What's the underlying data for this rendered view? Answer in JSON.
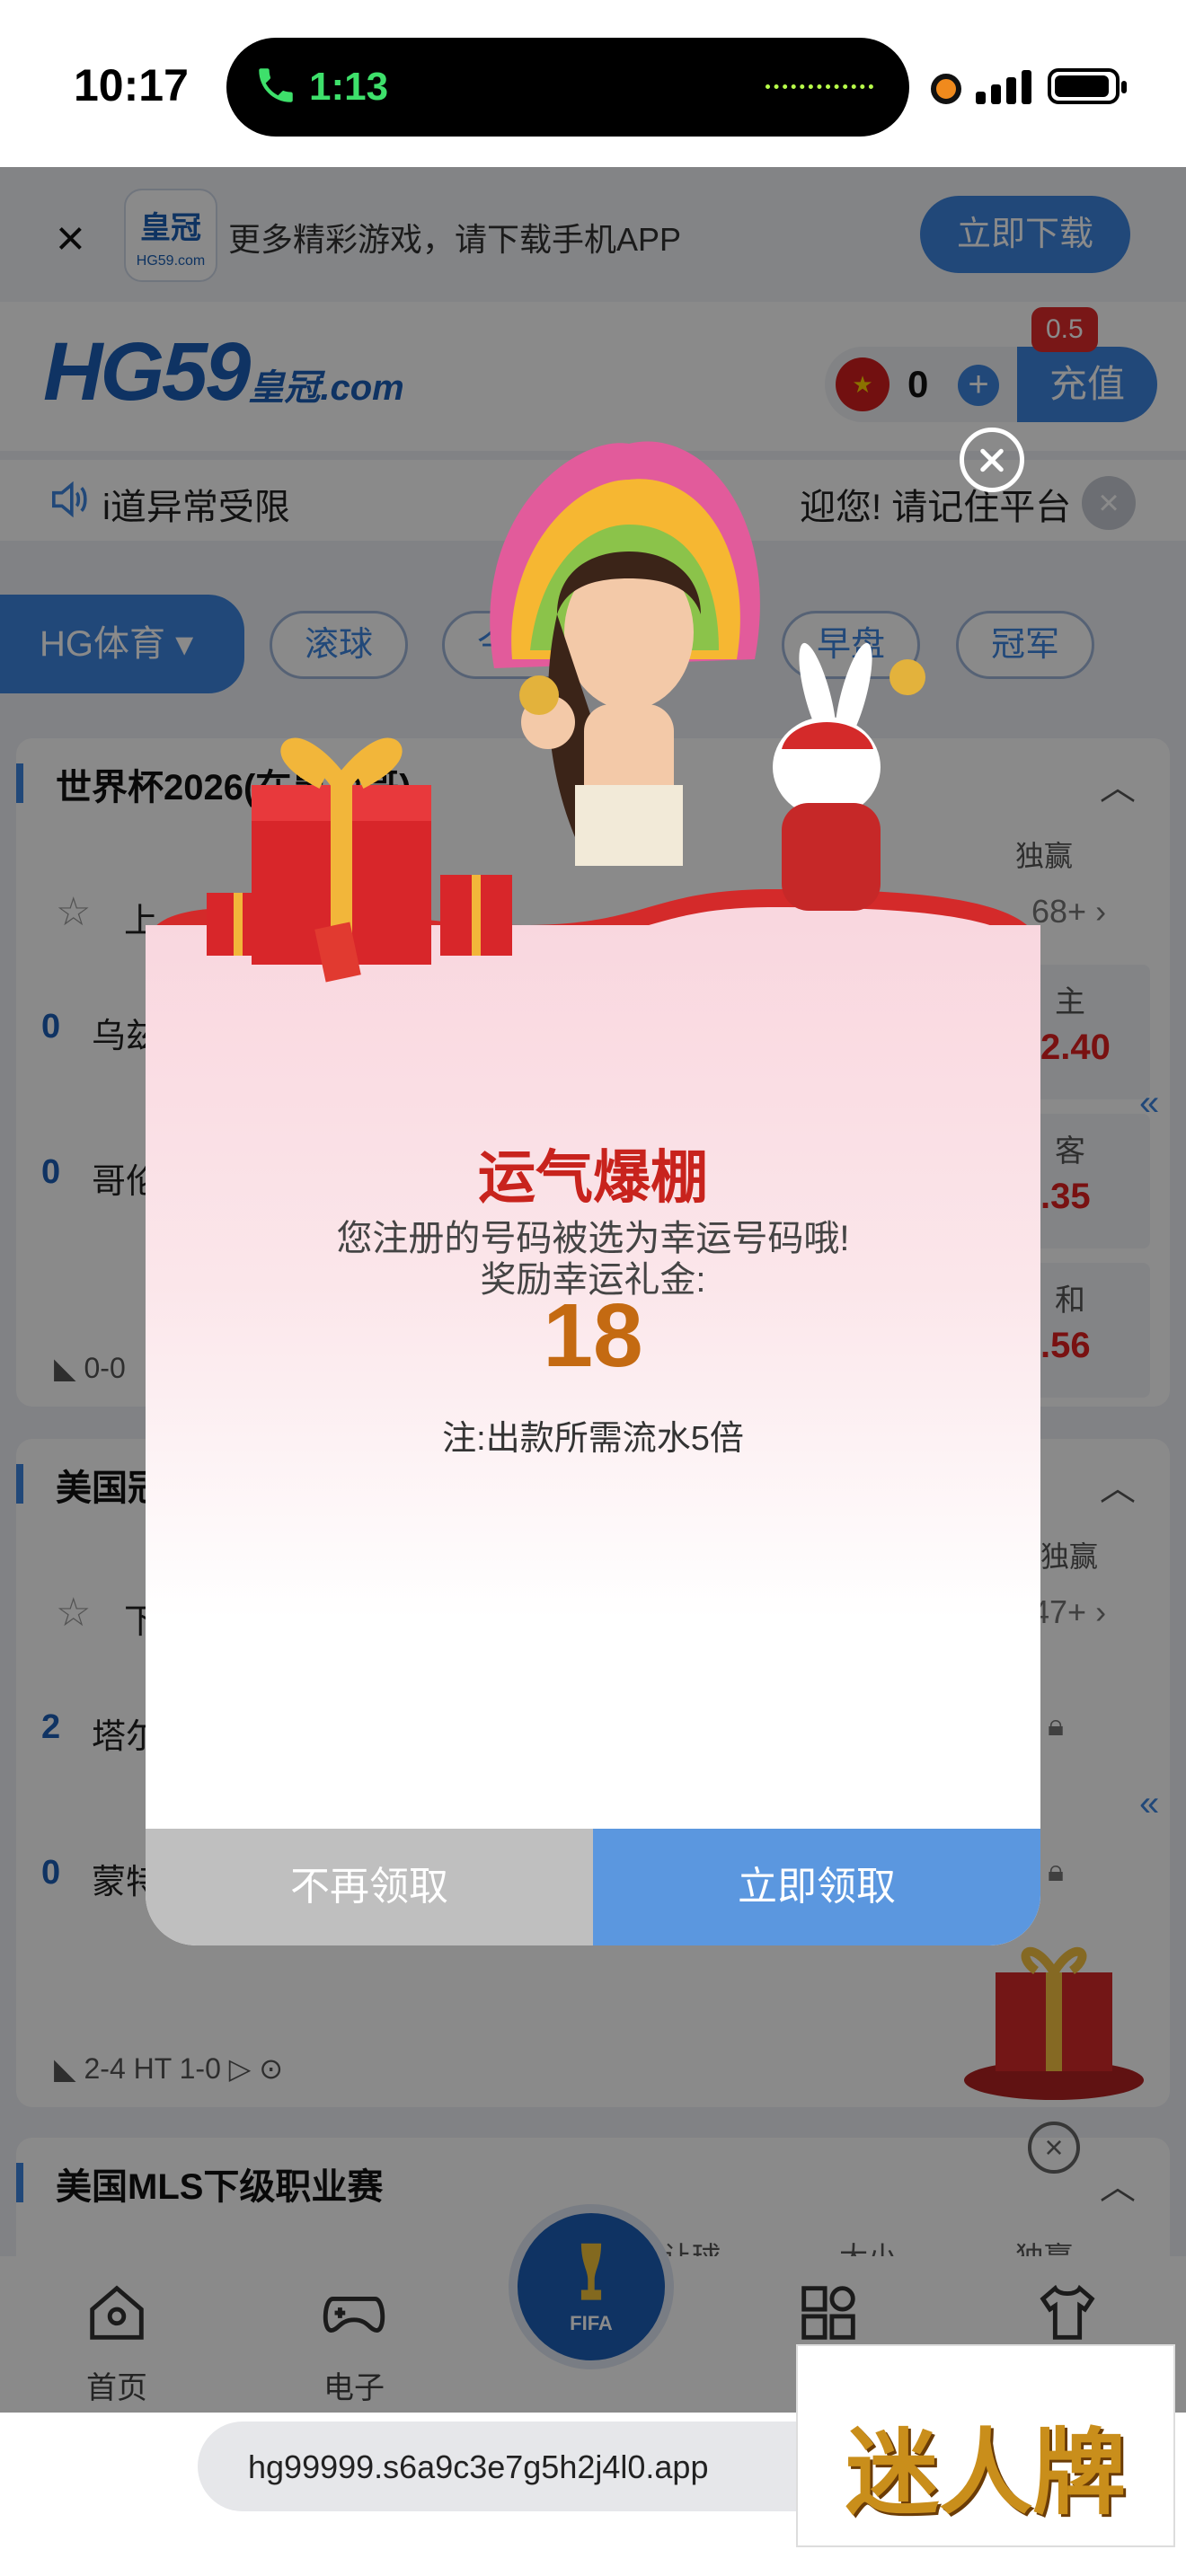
{
  "status_bar": {
    "time": "10:17",
    "call_time": "1:13"
  },
  "download_banner": {
    "logo_cn": "皇冠",
    "logo_domain": "HG59.com",
    "text": "更多精彩游戏，请下载手机APP",
    "button": "立即下载"
  },
  "header": {
    "brand": "HG59",
    "brand_cn": "皇冠",
    "brand_suffix": ".com",
    "balance": "0",
    "recharge": "充值",
    "bonus_badge": "0.5"
  },
  "marquee": {
    "left_text": "i道异常受限",
    "right_text": "迎您! 请记住平台"
  },
  "filters": {
    "main": "HG体育",
    "chips": [
      "滚球",
      "今日",
      "早盘",
      "冠军"
    ]
  },
  "matches": [
    {
      "league": "世界杯2026(在墨西哥)",
      "columns": [
        "独赢"
      ],
      "row_prefix": "上",
      "more": "68+",
      "teams": [
        {
          "score": "0",
          "name": "乌兹"
        },
        {
          "score": "0",
          "name": "哥伦"
        }
      ],
      "odds": [
        {
          "label": "主",
          "value": "2.40"
        },
        {
          "label": "客",
          "value": ".35"
        },
        {
          "label": "和",
          "value": ".56"
        }
      ],
      "live": "0-0"
    },
    {
      "league": "美国冠",
      "columns": [
        "独赢"
      ],
      "row_prefix": "下",
      "more": "47+",
      "teams": [
        {
          "score": "2",
          "name": "塔尔"
        },
        {
          "score": "0",
          "name": "蒙特"
        }
      ],
      "live": "2-4 HT 1-0"
    },
    {
      "league": "美国MLS下级职业赛",
      "columns": [
        "让球",
        "大小",
        "独赢"
      ]
    }
  ],
  "tabbar": {
    "tabs": [
      {
        "label": "首页",
        "icon": "home-icon"
      },
      {
        "label": "电子",
        "icon": "gamepad-icon"
      },
      {
        "label": "",
        "icon": "grid-icon"
      },
      {
        "label": "",
        "icon": "shirt-icon"
      }
    ],
    "center_label": "FIFA"
  },
  "modal": {
    "title": "运气爆棚",
    "line1": "您注册的号码被选为幸运号码哦!",
    "line2": "奖励幸运礼金:",
    "amount": "18",
    "note": "注:出款所需流水5倍",
    "decline": "不再领取",
    "accept": "立即领取"
  },
  "url": "hg99999.s6a9c3e7g5h2j4l0.app",
  "watermark": "迷人牌",
  "colors": {
    "accent": "#3d86e0",
    "title_red": "#c8231d",
    "amount_orange": "#c46a12",
    "odds_red": "#e02020"
  }
}
